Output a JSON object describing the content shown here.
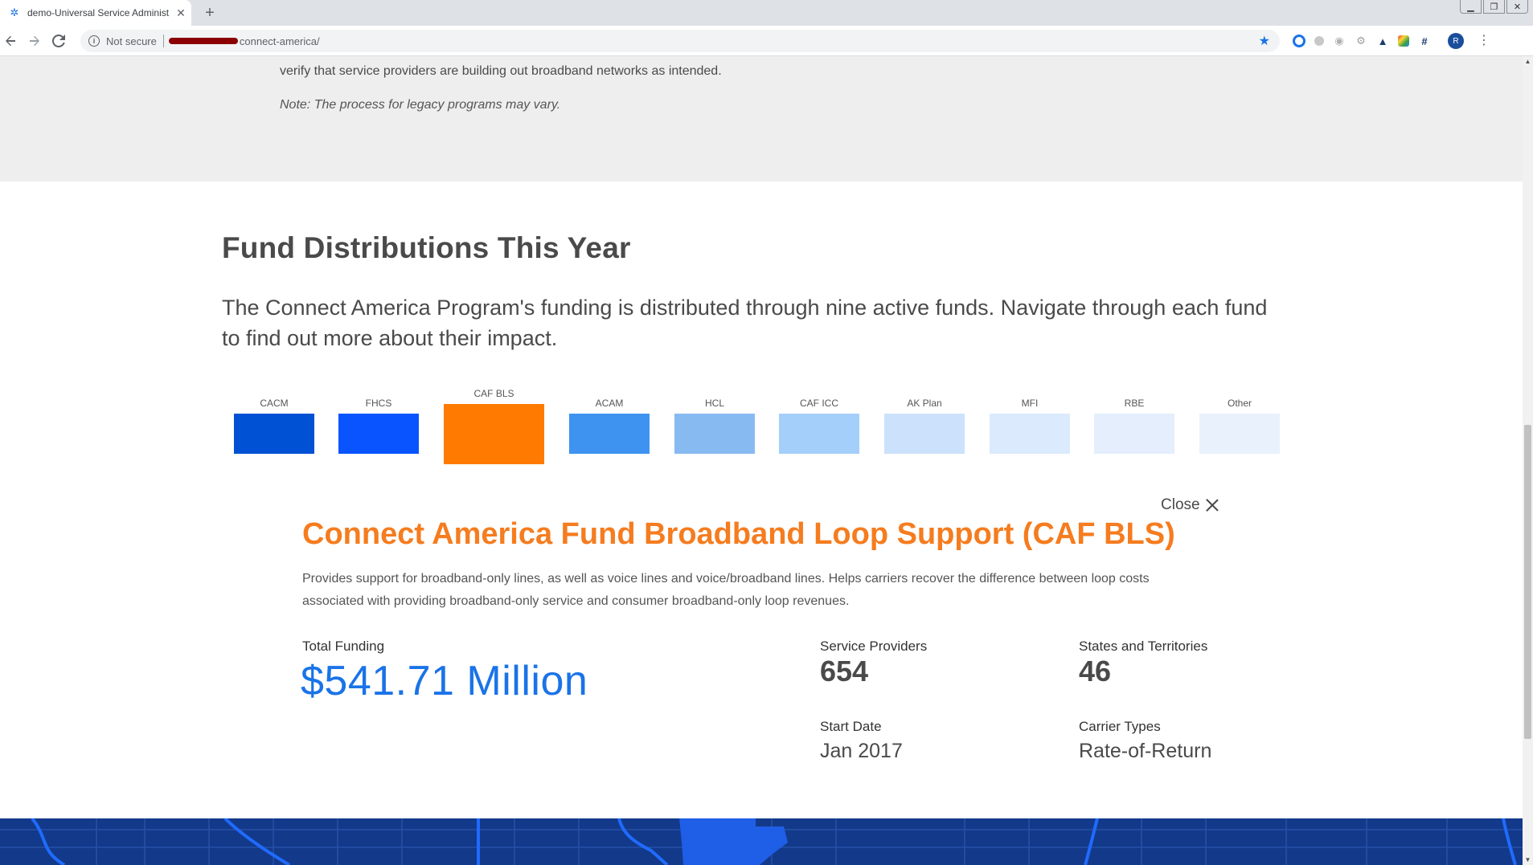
{
  "browser": {
    "tab_title": "demo-Universal Service Administ",
    "tab_close": "✕",
    "new_tab": "+",
    "security_label": "Not secure",
    "url": "connect-america/",
    "profile_initial": "R"
  },
  "page": {
    "intro_text": "verify that service providers are building out broadband networks as intended.",
    "note_text": "Note: The process for legacy programs may vary.",
    "section_title": "Fund Distributions This Year",
    "section_desc": "The Connect America Program's funding is distributed through nine active funds. Navigate through each fund to find out more about their impact."
  },
  "funds": [
    {
      "label": "CACM",
      "color": "#0051d4"
    },
    {
      "label": "FHCS",
      "color": "#0a54ff"
    },
    {
      "label": "CAF BLS",
      "color": "#ff7a00",
      "selected": true
    },
    {
      "label": "ACAM",
      "color": "#3e93f0"
    },
    {
      "label": "HCL",
      "color": "#88baf2"
    },
    {
      "label": "CAF ICC",
      "color": "#a4cffa"
    },
    {
      "label": "AK Plan",
      "color": "#cce1fb"
    },
    {
      "label": "MFI",
      "color": "#dbeafc"
    },
    {
      "label": "RBE",
      "color": "#e4eefc"
    },
    {
      "label": "Other",
      "color": "#e9f1fc"
    }
  ],
  "detail": {
    "close_label": "Close",
    "title": "Connect America Fund Broadband Loop Support (CAF BLS)",
    "description": "Provides support for broadband-only lines, as well as voice lines and voice/broadband lines. Helps carriers recover the difference between loop costs associated with providing broadband-only service and consumer broadband-only loop revenues.",
    "total_funding_label": "Total Funding",
    "total_funding_value": "$541.71 Million",
    "service_providers_label": "Service Providers",
    "service_providers_value": "654",
    "states_label": "States and Territories",
    "states_value": "46",
    "start_date_label": "Start Date",
    "start_date_value": "Jan 2017",
    "carrier_types_label": "Carrier Types",
    "carrier_types_value": "Rate-of-Return"
  },
  "colors": {
    "accent_orange": "#f57c1f",
    "funding_blue": "#1a73e8",
    "map_navy": "#13398a"
  }
}
